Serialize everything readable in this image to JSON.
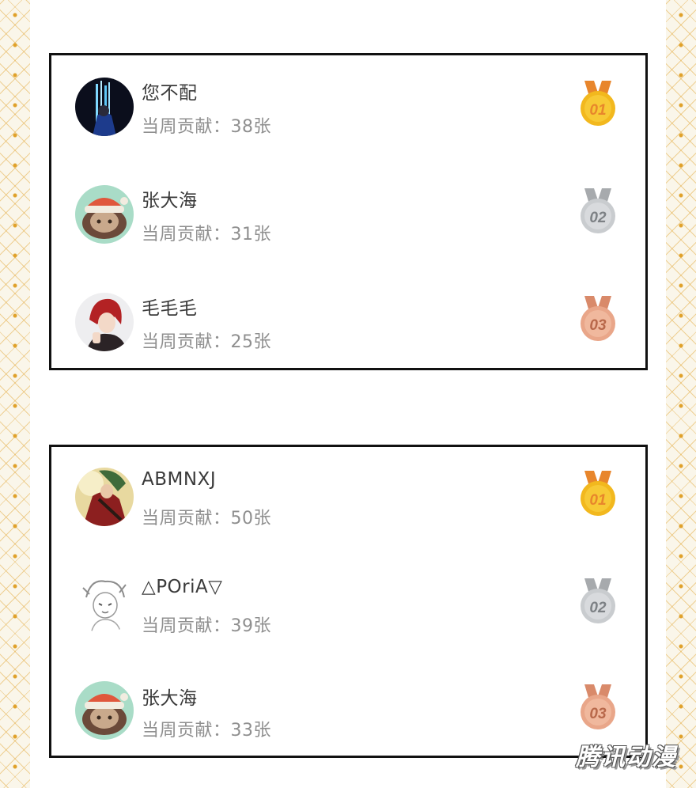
{
  "colors": {
    "gold": "#f2b81e",
    "gold_ribbon": "#e8862c",
    "silver": "#c9cccf",
    "silver_ribbon": "#a7aaad",
    "bronze": "#e9a689",
    "bronze_ribbon": "#d98a6a",
    "border_pattern": "#e0a12a"
  },
  "lists": [
    {
      "entries": [
        {
          "name": "您不配",
          "contribution": "当周贡献：38张",
          "medal": "01",
          "avatar": "avatar-waterfall-icon"
        },
        {
          "name": "张大海",
          "contribution": "当周贡献：31张",
          "medal": "02",
          "avatar": "avatar-sheep-icon"
        },
        {
          "name": "毛毛毛",
          "contribution": "当周贡献：25张",
          "medal": "03",
          "avatar": "avatar-redhair-icon"
        }
      ]
    },
    {
      "entries": [
        {
          "name": "ABMNXJ",
          "contribution": "当周贡献：50张",
          "medal": "01",
          "avatar": "avatar-warrior-icon"
        },
        {
          "name": "△POriA▽",
          "contribution": "当周贡献：39张",
          "medal": "02",
          "avatar": "avatar-sketch-icon"
        },
        {
          "name": "张大海",
          "contribution": "当周贡献：33张",
          "medal": "03",
          "avatar": "avatar-sheep-icon"
        }
      ]
    }
  ],
  "watermark": "腾讯动漫"
}
